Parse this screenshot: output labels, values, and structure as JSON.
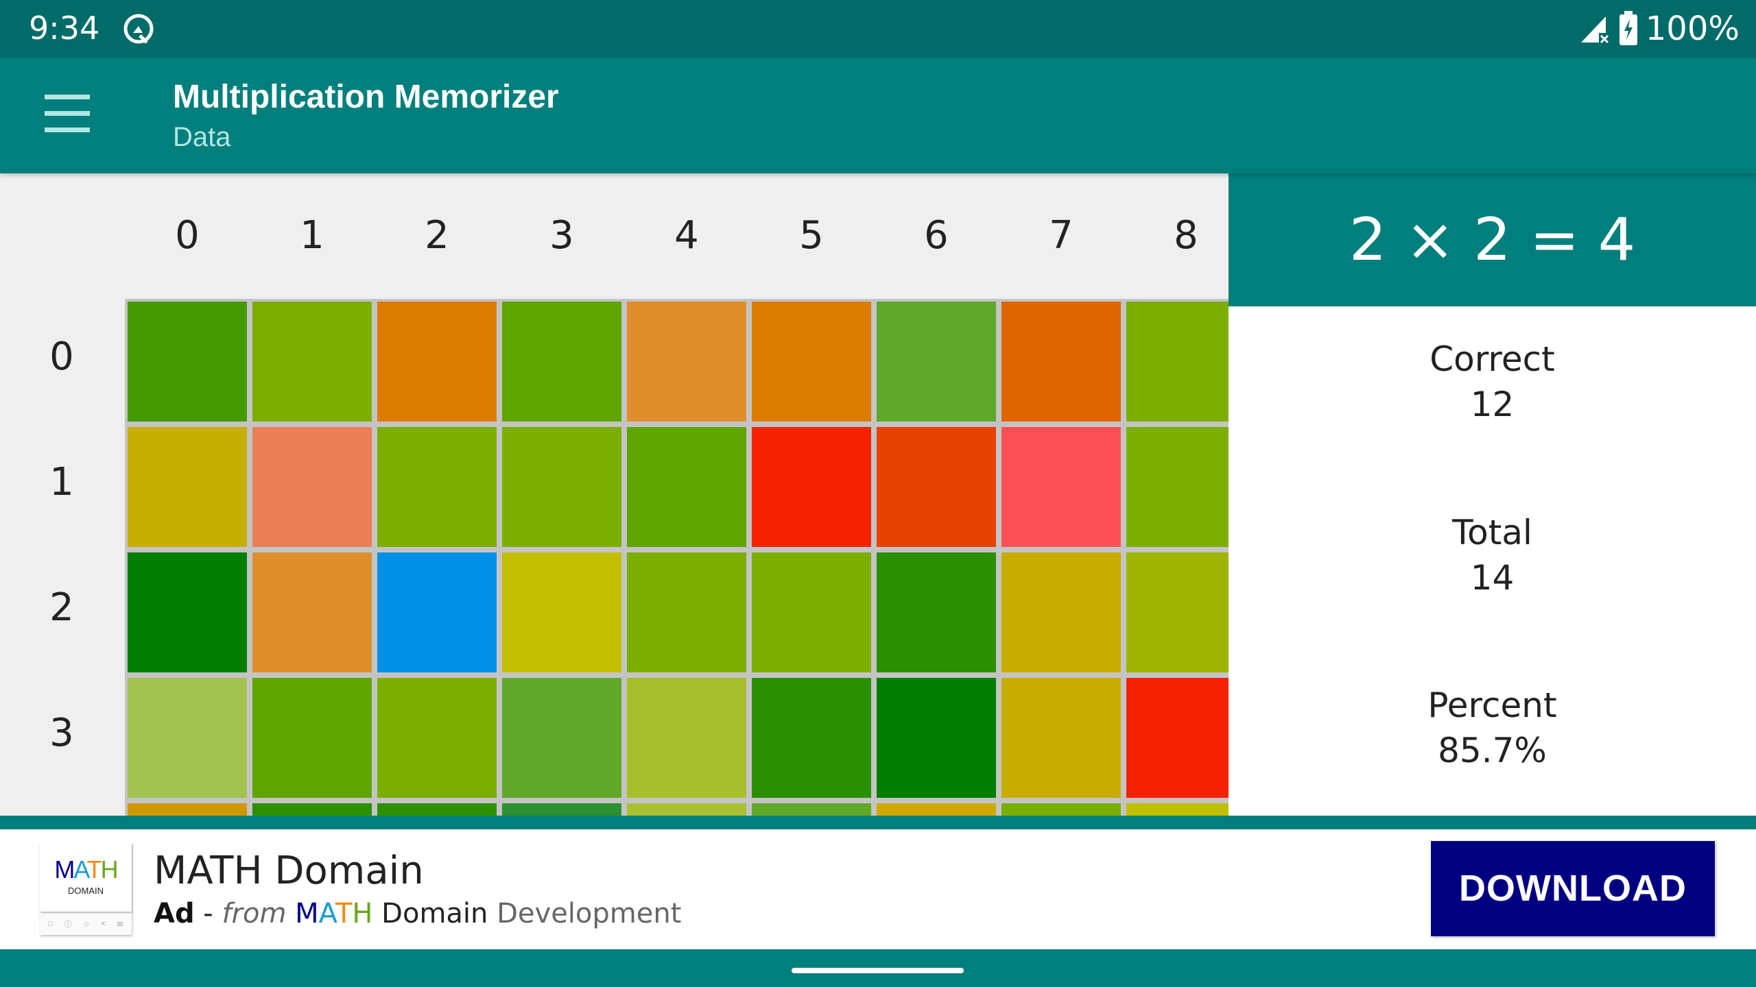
{
  "status_bar": {
    "time": "9:34",
    "notification_icon": "q-logo-icon",
    "signal_icon": "signal-no-service-icon",
    "battery_icon": "battery-charging-icon",
    "battery_percent": "100%"
  },
  "app_bar": {
    "menu_icon": "hamburger-menu-icon",
    "title": "Multiplication Memorizer",
    "subtitle": "Data"
  },
  "grid": {
    "column_labels": [
      "0",
      "1",
      "2",
      "3",
      "4",
      "5",
      "6",
      "7",
      "8"
    ],
    "row_labels": [
      "0",
      "1",
      "2",
      "3"
    ],
    "cell_colors": [
      [
        "#459a00",
        "#7cae00",
        "#db7c00",
        "#5fa500",
        "#de8f2c",
        "#db7c00",
        "#60a82a",
        "#e06400",
        "#7cae00"
      ],
      [
        "#c8ae00",
        "#ed7e56",
        "#7cae00",
        "#7cae00",
        "#5fa500",
        "#f52200",
        "#e84000",
        "#fd5055",
        "#7cae00"
      ],
      [
        "#007e00",
        "#de8f2c",
        "#0090e6",
        "#c2be00",
        "#7cae00",
        "#7cae00",
        "#2a9000",
        "#c9ac00",
        "#9db500"
      ],
      [
        "#a3c350",
        "#5fa500",
        "#7cae00",
        "#60a82a",
        "#a8bf2c",
        "#2a9000",
        "#007e00",
        "#c9ac00",
        "#f52200"
      ],
      [
        "#d09800",
        "#2a9000",
        "#2a9000",
        "#2a9030",
        "#a8c030",
        "#60a828",
        "#d0a800",
        "#78ae00",
        "#c0c000"
      ]
    ],
    "selected_cell": {
      "row": 2,
      "col": 2
    }
  },
  "detail_panel": {
    "equation": "2 × 2 = 4",
    "stats": [
      {
        "label": "Correct",
        "value": "12"
      },
      {
        "label": "Total",
        "value": "14"
      },
      {
        "label": "Percent",
        "value": "85.7%"
      }
    ]
  },
  "ad": {
    "icon_logo": {
      "letters": [
        "M",
        "A",
        "T",
        "H"
      ],
      "colors": [
        "#00008b",
        "#1a9ad6",
        "#f08a1c",
        "#6aa51c"
      ],
      "subtext": "DOMAIN"
    },
    "icon_actions": [
      "bookmark-icon",
      "info-icon",
      "star-icon",
      "share-icon",
      "mail-icon"
    ],
    "title": "MATH Domain",
    "label": "Ad",
    "separator": " - ",
    "from_text": "from",
    "brand_letters": [
      "M",
      "A",
      "T",
      "H"
    ],
    "brand_colors": [
      "#00008b",
      "#1a9ad6",
      "#f08a1c",
      "#6aa51c"
    ],
    "brand_rest": " Domain",
    "developer_suffix": " Development",
    "download_label": "DOWNLOAD",
    "button_color": "#000080"
  },
  "nav": {
    "handle": "home-gesture-handle"
  },
  "colors": {
    "primary": "#007f7c",
    "primary_dark": "#006b68"
  }
}
